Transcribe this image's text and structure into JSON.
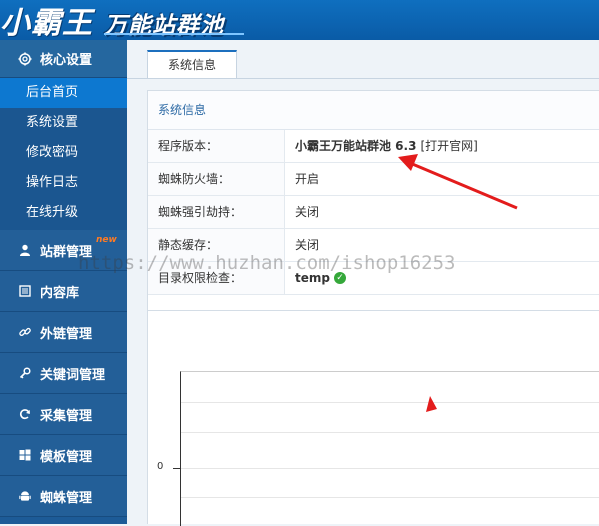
{
  "header": {
    "logo_main": "小霸王",
    "logo_sub": "万能站群池"
  },
  "sidebar": {
    "section": {
      "label": "核心设置",
      "icon": "gear-icon"
    },
    "sub_items": [
      {
        "label": "后台首页",
        "active": true
      },
      {
        "label": "系统设置"
      },
      {
        "label": "修改密码"
      },
      {
        "label": "操作日志"
      },
      {
        "label": "在线升级"
      }
    ],
    "categories": [
      {
        "label": "站群管理",
        "icon": "user-icon",
        "badge": "new"
      },
      {
        "label": "内容库",
        "icon": "list-icon"
      },
      {
        "label": "外链管理",
        "icon": "link-icon"
      },
      {
        "label": "关键词管理",
        "icon": "key-icon"
      },
      {
        "label": "采集管理",
        "icon": "refresh-icon"
      },
      {
        "label": "模板管理",
        "icon": "windows-icon"
      },
      {
        "label": "蜘蛛管理",
        "icon": "android-icon"
      }
    ]
  },
  "main": {
    "tab": "系统信息",
    "panel_title": "系统信息",
    "rows": [
      {
        "key": "程序版本：",
        "value": "小霸王万能站群池 6.3",
        "link": "[打开官网]"
      },
      {
        "key": "蜘蛛防火墙：",
        "value": "开启"
      },
      {
        "key": "蜘蛛强引劫持：",
        "value": "关闭"
      },
      {
        "key": "静态缓存：",
        "value": "关闭"
      },
      {
        "key": "目录权限检查：",
        "value": "temp",
        "status": "ok"
      }
    ]
  },
  "chart_data": {
    "type": "line",
    "y_ticks": [
      "0"
    ]
  },
  "watermark": "https://www.huzhan.com/ishop16253",
  "colors": {
    "header": "#0f6fbf",
    "sidebar": "#1d5b97",
    "active_item": "#0d78d0",
    "arrow": "#e31c1c",
    "badge": "#ff7b24"
  }
}
